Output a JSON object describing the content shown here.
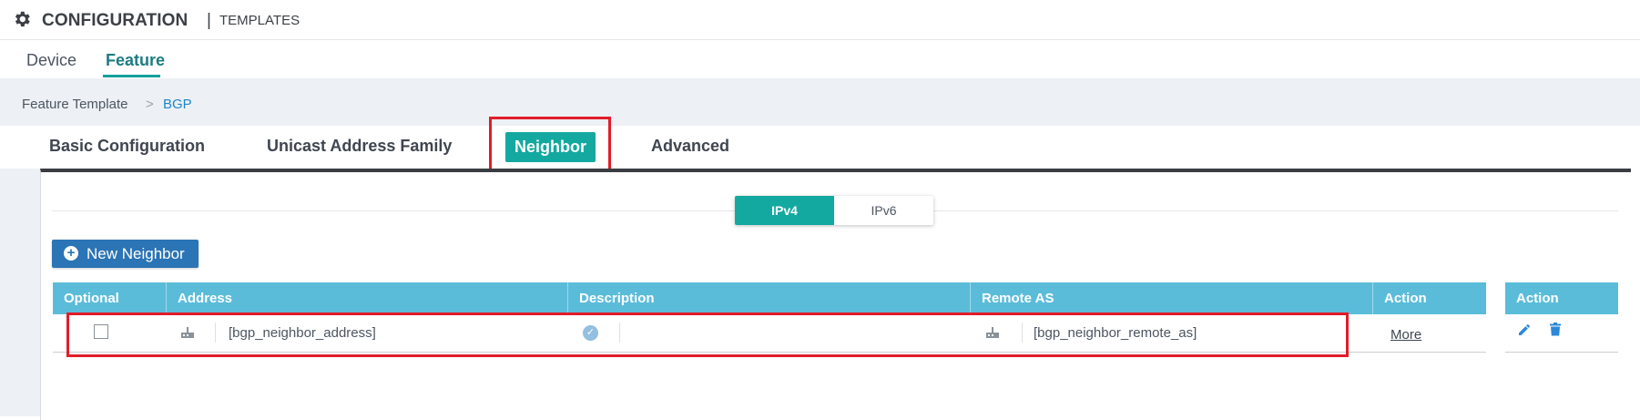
{
  "header": {
    "title": "CONFIGURATION",
    "separator": "|",
    "subtitle": "TEMPLATES"
  },
  "main_tabs": [
    {
      "label": "Device",
      "active": false
    },
    {
      "label": "Feature",
      "active": true
    }
  ],
  "breadcrumb": {
    "parent": "Feature Template",
    "separator": ">",
    "current": "BGP"
  },
  "section_tabs": [
    {
      "label": "Basic Configuration",
      "active": false
    },
    {
      "label": "Unicast Address Family",
      "active": false
    },
    {
      "label": "Neighbor",
      "active": true
    },
    {
      "label": "Advanced",
      "active": false
    }
  ],
  "ip_toggle": {
    "options": [
      "IPv4",
      "IPv6"
    ],
    "selected": "IPv4"
  },
  "new_neighbor_button": "New Neighbor",
  "table": {
    "columns": [
      "Optional",
      "Address",
      "Description",
      "Remote AS",
      "Action"
    ],
    "action_column": "Action",
    "rows": [
      {
        "optional": false,
        "address": "[bgp_neighbor_address]",
        "description": "",
        "remote_as": "[bgp_neighbor_remote_as]",
        "action_link": "More"
      }
    ]
  },
  "colors": {
    "accent_teal": "#14a9a0",
    "header_blue": "#5bbcd9",
    "button_blue": "#2b74b5",
    "highlight_red": "#e11d2a"
  },
  "icons": [
    "gear-icon",
    "plus-circle-icon",
    "device-icon",
    "check-circle-icon",
    "edit-pencil-icon",
    "trash-icon"
  ]
}
